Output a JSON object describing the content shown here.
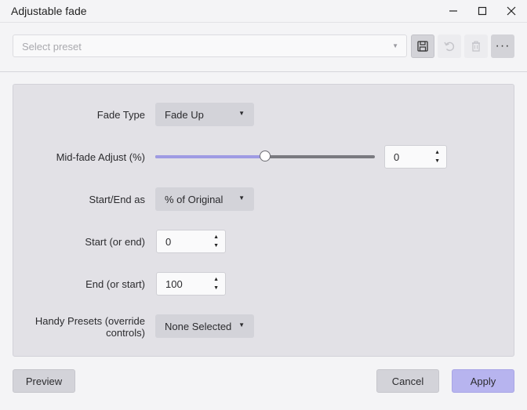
{
  "window": {
    "title": "Adjustable fade",
    "controls": [
      "minimize-icon",
      "maximize-icon",
      "close-icon"
    ]
  },
  "preset_bar": {
    "placeholder": "Select preset",
    "buttons": [
      {
        "icon": "save-icon"
      },
      {
        "icon": "undo-icon"
      },
      {
        "icon": "trash-icon"
      },
      {
        "icon": "more-icon",
        "text": "···"
      }
    ]
  },
  "fields": {
    "fade_type": {
      "label": "Fade Type",
      "value": "Fade Up"
    },
    "mid_fade": {
      "label": "Mid-fade Adjust (%)",
      "value": "0",
      "slider_fraction": 0.5
    },
    "start_end_as": {
      "label": "Start/End as",
      "value": "% of Original"
    },
    "start": {
      "label": "Start (or end)",
      "value": "0"
    },
    "end": {
      "label": "End (or start)",
      "value": "100"
    },
    "handy_presets": {
      "label_line1": "Handy Presets (override",
      "label_line2": "controls)",
      "value": "None Selected"
    }
  },
  "glyphs": {
    "arrow_down": "▼",
    "arrow_up": "▲"
  },
  "footer": {
    "preview": "Preview",
    "cancel": "Cancel",
    "apply": "Apply"
  },
  "colors": {
    "accent": "#9f9be3",
    "apply_button": "#b7b4ef",
    "panel": "#e2e1e6"
  }
}
